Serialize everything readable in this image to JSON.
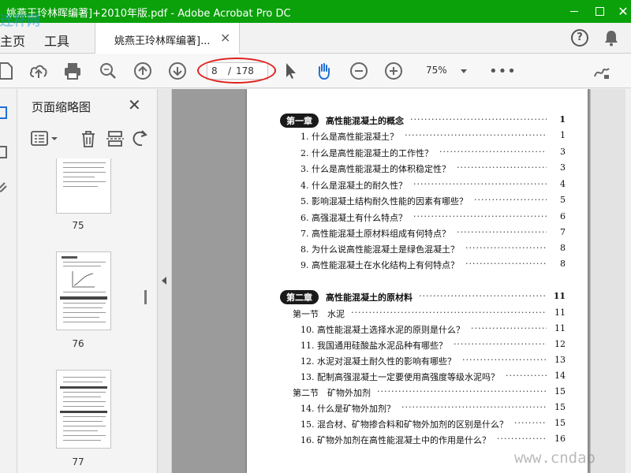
{
  "window": {
    "title": "姚燕王玲林晖编著]+2010年版.pdf - Adobe Acrobat Pro DC",
    "minimize": "minimize-icon",
    "maximize": "maximize-icon",
    "close_label": "✕",
    "corner_logo": "连杯网"
  },
  "menu": {
    "home_label": "主页",
    "tools_label": "工具",
    "doc_tab_label": "姚燕王玲林晖编著]...",
    "doc_tab_close": "×"
  },
  "toolbar": {
    "icons": [
      "create-pdf-icon",
      "upload-icon",
      "print-icon",
      "search-icon",
      "page-up-icon",
      "page-down-icon",
      "select-cursor-icon",
      "hand-tool-icon",
      "zoom-out-icon",
      "zoom-in-icon",
      "more-icon",
      "sign-icon"
    ],
    "page_current": "8",
    "page_separator": "/",
    "page_total": "178",
    "zoom_value": "75%",
    "more_label": "•••"
  },
  "thumb_panel": {
    "title": "页面缩略图",
    "close_label": "✕",
    "pages": [
      "75",
      "76",
      "77"
    ]
  },
  "toc": [
    {
      "type": "chapter",
      "badge": "第一章",
      "text": "高性能混凝土的概念",
      "page": "1"
    },
    {
      "type": "item",
      "text": "1. 什么是高性能混凝土？",
      "page": "1"
    },
    {
      "type": "item",
      "text": "2. 什么是高性能混凝土的工作性？",
      "page": "3"
    },
    {
      "type": "item",
      "text": "3. 什么是高性能混凝土的体积稳定性？",
      "page": "3"
    },
    {
      "type": "item",
      "text": "4. 什么是混凝土的耐久性？",
      "page": "4"
    },
    {
      "type": "item",
      "text": "5. 影响混凝土结构耐久性能的因素有哪些？",
      "page": "5"
    },
    {
      "type": "item",
      "text": "6. 高强混凝土有什么特点？",
      "page": "6"
    },
    {
      "type": "item",
      "text": "7. 高性能混凝土原材料组成有何特点？",
      "page": "7"
    },
    {
      "type": "item",
      "text": "8. 为什么说高性能混凝土是绿色混凝土？",
      "page": "8"
    },
    {
      "type": "item",
      "text": "9. 高性能混凝土在水化结构上有何特点？",
      "page": "8"
    },
    {
      "type": "chapter",
      "badge": "第二章",
      "text": "高性能混凝土的原材料",
      "page": "11"
    },
    {
      "type": "section",
      "text": "第一节　水泥",
      "page": "11"
    },
    {
      "type": "item",
      "text": "10. 高性能混凝土选择水泥的原则是什么？",
      "page": "11"
    },
    {
      "type": "item",
      "text": "11. 我国通用硅酸盐水泥品种有哪些？",
      "page": "12"
    },
    {
      "type": "item",
      "text": "12. 水泥对混凝土耐久性的影响有哪些？",
      "page": "13"
    },
    {
      "type": "item",
      "text": "13. 配制高强混凝土一定要使用高强度等级水泥吗？",
      "page": "14"
    },
    {
      "type": "section",
      "text": "第二节　矿物外加剂",
      "page": "15"
    },
    {
      "type": "item",
      "text": "14. 什么是矿物外加剂？",
      "page": "15"
    },
    {
      "type": "item",
      "text": "15. 混合材、矿物掺合料和矿物外加剂的区别是什么？",
      "page": "15"
    },
    {
      "type": "item",
      "text": "16. 矿物外加剂在高性能混凝土中的作用是什么？",
      "page": "16"
    }
  ],
  "watermark": "www.cndao"
}
